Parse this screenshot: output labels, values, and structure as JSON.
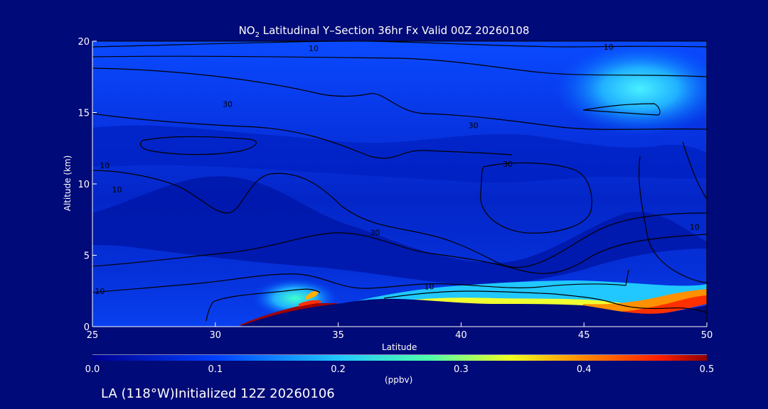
{
  "chart_data": {
    "type": "heatmap",
    "title": {
      "prefix": "NO",
      "subscript": "2",
      "rest": " Latitudinal Y–Section 36hr  Fx Valid 00Z 20260108"
    },
    "xlabel": "Latitude",
    "ylabel": "Altitude (km)",
    "xlim": [
      25,
      50
    ],
    "ylim": [
      0,
      20
    ],
    "x_ticks": [
      25,
      30,
      35,
      40,
      45,
      50
    ],
    "y_ticks": [
      0,
      5,
      10,
      15,
      20
    ],
    "colorbar": {
      "label": "(ppbv)",
      "range": [
        0.0,
        0.5
      ],
      "tick_labels": [
        "0.0",
        "0.1",
        "0.2",
        "0.3",
        "0.4",
        "0.5"
      ],
      "colors": [
        "#0000a0",
        "#0020e8",
        "#0070ff",
        "#18d0ff",
        "#40ffb8",
        "#e0ff20",
        "#ffb000",
        "#ff4000",
        "#a00000"
      ]
    },
    "terrain_km": [
      [
        25,
        0
      ],
      [
        31.5,
        0
      ],
      [
        32,
        0.2
      ],
      [
        34,
        0.9
      ],
      [
        35,
        1.2
      ],
      [
        36,
        1.6
      ],
      [
        37,
        1.7
      ],
      [
        38,
        1.6
      ],
      [
        40,
        1.3
      ],
      [
        42,
        1.2
      ],
      [
        44,
        1.2
      ],
      [
        45,
        1.0
      ],
      [
        47,
        0.6
      ],
      [
        48,
        0.4
      ],
      [
        50,
        1.0
      ]
    ],
    "no2_features": [
      {
        "lat_range": [
          31.5,
          35
        ],
        "alt_range": [
          0,
          1.4
        ],
        "value": 0.5
      },
      {
        "lat_range": [
          33.5,
          34.8
        ],
        "alt_range": [
          1.5,
          2.3
        ],
        "value": 0.35
      },
      {
        "lat_range": [
          38,
          45
        ],
        "alt_range": [
          1.3,
          2.2
        ],
        "value": 0.3
      },
      {
        "lat_range": [
          45,
          50
        ],
        "alt_range": [
          0.6,
          2.4
        ],
        "value": 0.45
      },
      {
        "lat_range": [
          44,
          49
        ],
        "alt_range": [
          14,
          18
        ],
        "value": 0.18
      }
    ],
    "contour_labels": [
      {
        "text": "10",
        "lat": 34,
        "alt": 19.5
      },
      {
        "text": "10",
        "lat": 46,
        "alt": 19.6
      },
      {
        "text": "30",
        "lat": 30.5,
        "alt": 15.6
      },
      {
        "text": "30",
        "lat": 40.5,
        "alt": 14.1
      },
      {
        "text": "30",
        "lat": 41.9,
        "alt": 11.4
      },
      {
        "text": "10",
        "lat": 25.5,
        "alt": 11.3
      },
      {
        "text": "10",
        "lat": 26,
        "alt": 9.6
      },
      {
        "text": "30",
        "lat": 36.5,
        "alt": 6.6
      },
      {
        "text": "10",
        "lat": 49.5,
        "alt": 7.0
      },
      {
        "text": "10",
        "lat": 25.3,
        "alt": 2.5
      },
      {
        "text": "10",
        "lat": 38.7,
        "alt": 2.8
      }
    ]
  },
  "footer": "LA (118°W)Initialized 12Z 20260106"
}
